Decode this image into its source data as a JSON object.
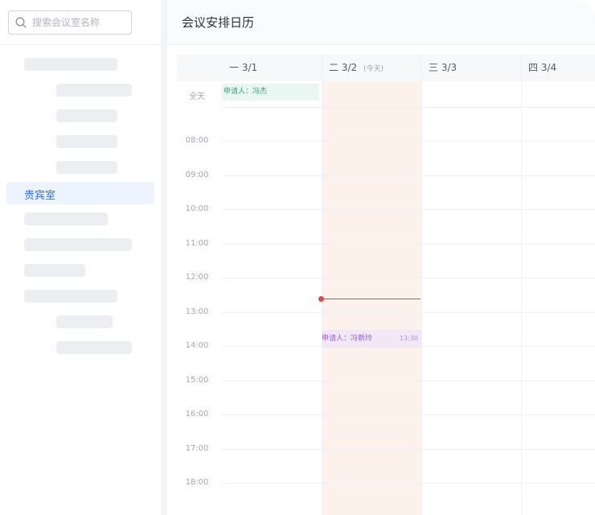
{
  "sidebar": {
    "search": {
      "placeholder": "搜索会议室名称",
      "value": ""
    },
    "active_room": "贵宾室"
  },
  "header": {
    "title": "会议安排日历"
  },
  "calendar": {
    "days": [
      {
        "weekday": "一",
        "date": "3/1",
        "today_tag": ""
      },
      {
        "weekday": "二",
        "date": "3/2",
        "today_tag": "(今天)"
      },
      {
        "weekday": "三",
        "date": "3/3",
        "today_tag": ""
      },
      {
        "weekday": "四",
        "date": "3/4",
        "today_tag": ""
      }
    ],
    "allday_label": "全天",
    "hours": [
      "08:00",
      "09:00",
      "10:00",
      "11:00",
      "12:00",
      "13:00",
      "14:00",
      "15:00",
      "16:00",
      "17:00",
      "18:00"
    ],
    "events": [
      {
        "text": "申请人：冯杰",
        "time": ""
      },
      {
        "text": "申请人：冯新玲",
        "time": "13:30"
      }
    ]
  },
  "colors": {
    "accent": "#3a6fd8",
    "today_bg": "#fdf1ec",
    "now_line": "#e04848"
  }
}
